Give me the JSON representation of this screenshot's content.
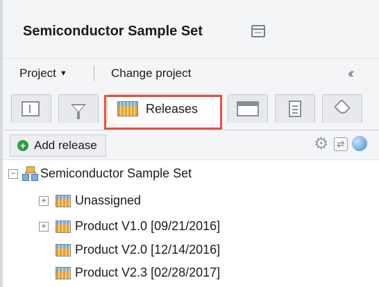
{
  "header": {
    "title": "Semiconductor Sample Set",
    "title_icon": "layout-icon"
  },
  "project_bar": {
    "project_menu_label": "Project",
    "change_project_label": "Change project",
    "collapse_icon": "double-chevron-left-icon"
  },
  "tabs": [
    {
      "name": "tree-view",
      "icon": "list-icon",
      "label": ""
    },
    {
      "name": "filter",
      "icon": "filter-icon",
      "label": ""
    },
    {
      "name": "releases",
      "icon": "release-icon",
      "label": "Releases",
      "active": true,
      "highlight_color": "#e2543b"
    },
    {
      "name": "window",
      "icon": "window-icon",
      "label": ""
    },
    {
      "name": "document",
      "icon": "document-icon",
      "label": ""
    },
    {
      "name": "tag",
      "icon": "tag-icon",
      "label": ""
    }
  ],
  "toolbar": {
    "add_release_label": "Add release",
    "add_icon_color": "#2f9c45",
    "icons": [
      "gear-icon",
      "swap-icon",
      "help-icon"
    ]
  },
  "tree": {
    "root": {
      "label": "Semiconductor Sample Set",
      "expanded": true
    },
    "items": [
      {
        "label": "Unassigned",
        "expandable": true
      },
      {
        "label": "Product V1.0 [09/21/2016]",
        "expandable": true
      },
      {
        "label": "Product V2.0 [12/14/2016]",
        "expandable": false
      },
      {
        "label": "Product V2.3 [02/28/2017]",
        "expandable": false
      }
    ]
  }
}
